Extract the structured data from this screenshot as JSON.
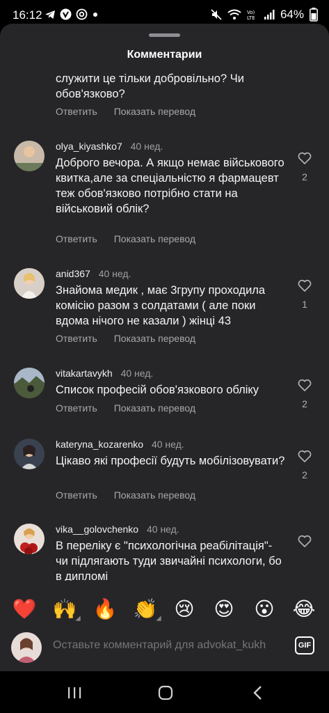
{
  "status": {
    "time": "16:12",
    "battery": "64%",
    "left_icons": [
      "telegram-icon",
      "viber-icon",
      "at-sign-icon",
      "dot-icon"
    ],
    "right_icons": [
      "mute-icon",
      "wifi-icon",
      "volte-icon",
      "signal-icon"
    ]
  },
  "sheet": {
    "title": "Комментарии"
  },
  "actions": {
    "reply": "Ответить",
    "translate": "Показать перевод"
  },
  "comments": [
    {
      "user": "",
      "when": "",
      "text": "служити це тільки добровільно? Чи обов'язково?",
      "likes": ""
    },
    {
      "user": "olya_kiyashko7",
      "when": "40 нед.",
      "text": "Доброго вечора. А якщо немає військового квитка,але за спеціальністю я фармацевт теж обов'язково потрібно стати на військовий облік?",
      "likes": "2"
    },
    {
      "user": "anid367",
      "when": "40 нед.",
      "text": "Знайома медик , має 3групу проходила комісію разом з солдатами ( але поки вдома  нічого не казали ) жінці 43",
      "likes": "1"
    },
    {
      "user": "vitakartavykh",
      "when": "40 нед.",
      "text": "Список професій обов'язкового обліку",
      "likes": "2"
    },
    {
      "user": "kateryna_kozarenko",
      "when": "40 нед.",
      "text": "Цікаво які професії будуть мобілізовувати?",
      "likes": "2"
    },
    {
      "user": "vika__golovchenko",
      "when": "40 нед.",
      "text": "В переліку є \"психологічна реабілітація\"- чи підлягають туди звичайні психологи, бо в дипломі",
      "likes": ""
    }
  ],
  "emojis": [
    "❤️",
    "🙌",
    "🔥",
    "👏",
    "😢",
    "😍",
    "😮",
    "😂"
  ],
  "composer": {
    "placeholder": "Оставьте комментарий для advokat_kukh",
    "gif": "GIF"
  },
  "colors": {
    "sheet_bg": "#262628",
    "text": "#f5f5f5",
    "muted": "#a8a8a8"
  }
}
